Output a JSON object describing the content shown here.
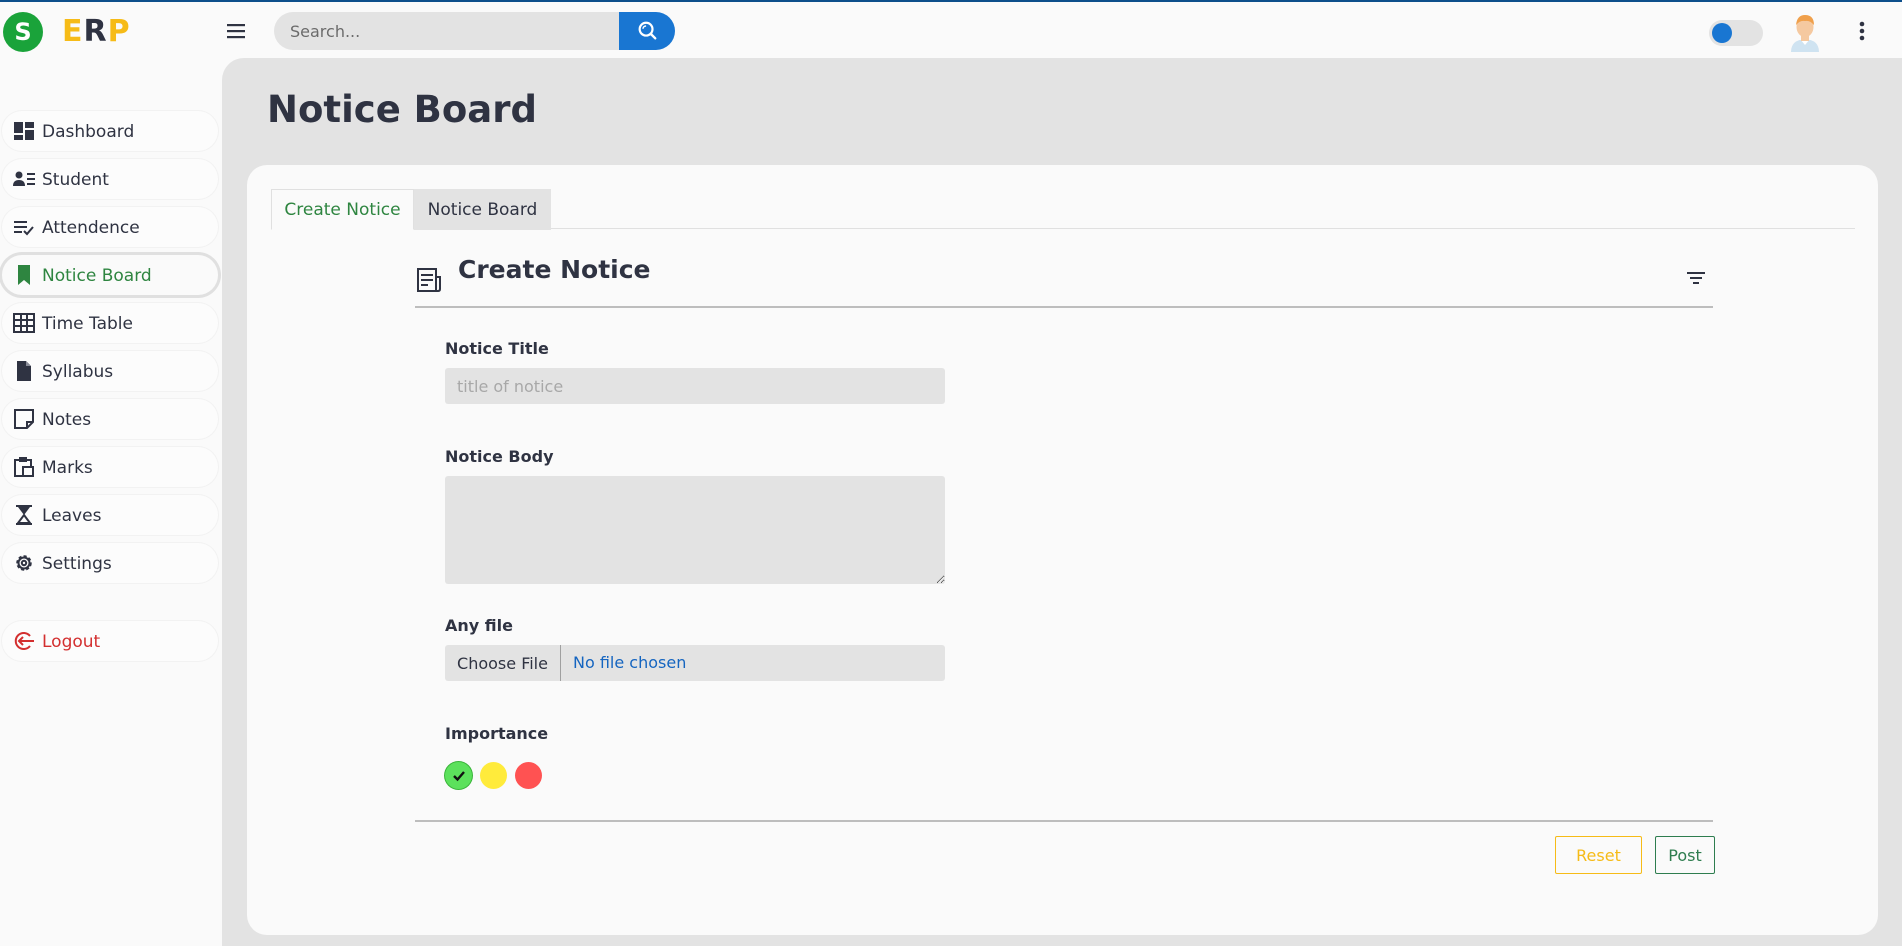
{
  "brand": {
    "logo_letter": "S",
    "name_e": "E",
    "name_r": "R",
    "name_p": "P"
  },
  "header": {
    "search_placeholder": "Search...",
    "menu_icon": "hamburger-menu-icon",
    "search_icon": "search-icon",
    "theme_toggle_on": true,
    "avatar_icon": "user-avatar-icon",
    "more_icon": "kebab-menu-icon"
  },
  "sidebar": {
    "items": [
      {
        "label": "Dashboard",
        "icon": "dashboard-icon"
      },
      {
        "label": "Student",
        "icon": "student-icon"
      },
      {
        "label": "Attendence",
        "icon": "attendance-icon"
      },
      {
        "label": "Notice Board",
        "icon": "bookmark-icon",
        "active": true
      },
      {
        "label": "Time Table",
        "icon": "table-icon"
      },
      {
        "label": "Syllabus",
        "icon": "document-icon"
      },
      {
        "label": "Notes",
        "icon": "sticky-note-icon"
      },
      {
        "label": "Marks",
        "icon": "clipboard-icon"
      },
      {
        "label": "Leaves",
        "icon": "hourglass-icon"
      },
      {
        "label": "Settings",
        "icon": "gear-icon"
      }
    ],
    "logout": {
      "label": "Logout",
      "icon": "logout-icon"
    }
  },
  "main": {
    "page_title": "Notice Board",
    "tabs": [
      {
        "label": "Create Notice",
        "active": true
      },
      {
        "label": "Notice Board",
        "active": false
      }
    ],
    "form": {
      "title": "Create Notice",
      "notice_title_label": "Notice Title",
      "notice_title_placeholder": "title of notice",
      "notice_title_value": "",
      "notice_body_label": "Notice Body",
      "notice_body_value": "",
      "file_label": "Any file",
      "file_button": "Choose File",
      "file_status": "No file chosen",
      "importance_label": "Importance",
      "importance_options": [
        {
          "color": "#5ce15c",
          "selected": true
        },
        {
          "color": "#ffeb3b",
          "selected": false
        },
        {
          "color": "#ff5252",
          "selected": false
        }
      ],
      "reset_label": "Reset",
      "post_label": "Post"
    }
  },
  "colors": {
    "accent_blue": "#1976d2",
    "active_green": "#2e8540",
    "logout_red": "#d32f2f",
    "brand_yellow": "#f6bb17"
  }
}
